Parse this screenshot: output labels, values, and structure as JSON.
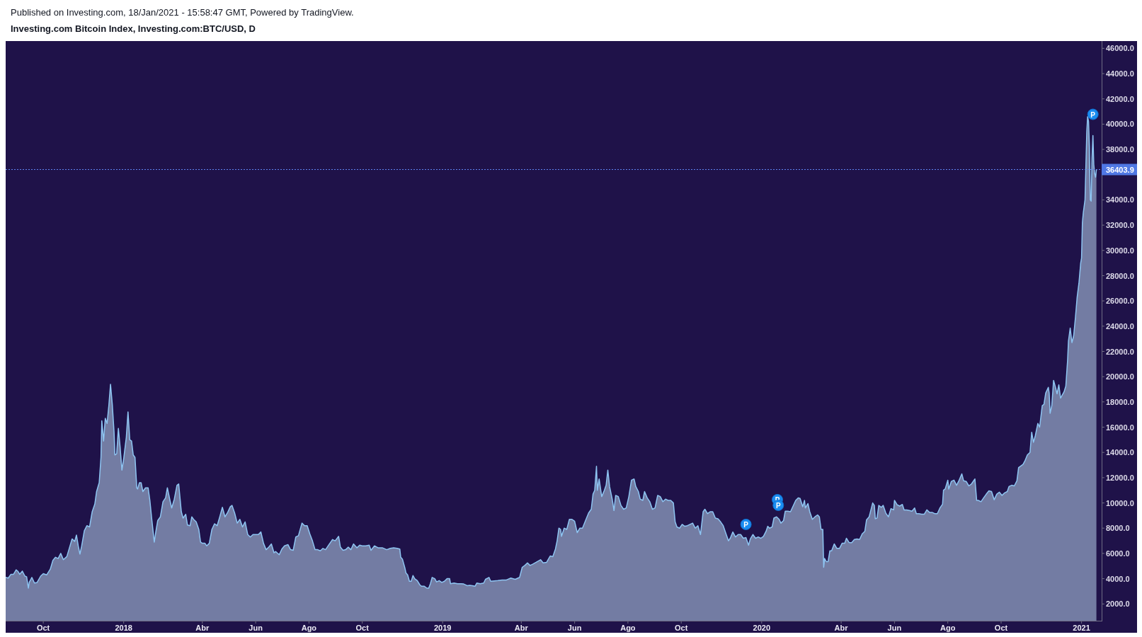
{
  "header": {
    "published": "Published on Investing.com, 18/Jan/2021 - 15:58:47 GMT, Powered by TradingView.",
    "title": "Investing.com Bitcoin Index, Investing.com:BTC/USD, D"
  },
  "chart": {
    "chart_data": {
      "type": "area",
      "x": [
        "2017-08-19",
        "2017-08-22",
        "2017-08-25",
        "2017-08-28",
        "2017-08-31",
        "2017-09-02",
        "2017-09-04",
        "2017-09-07",
        "2017-09-10",
        "2017-09-12",
        "2017-09-14",
        "2017-09-15",
        "2017-09-18",
        "2017-09-21",
        "2017-09-24",
        "2017-09-28",
        "2017-10-01",
        "2017-10-05",
        "2017-10-09",
        "2017-10-12",
        "2017-10-15",
        "2017-10-18",
        "2017-10-21",
        "2017-10-24",
        "2017-10-28",
        "2017-10-31",
        "2017-11-03",
        "2017-11-06",
        "2017-11-08",
        "2017-11-10",
        "2017-11-12",
        "2017-11-14",
        "2017-11-17",
        "2017-11-20",
        "2017-11-23",
        "2017-11-26",
        "2017-11-29",
        "2017-12-01",
        "2017-12-04",
        "2017-12-06",
        "2017-12-07",
        "2017-12-09",
        "2017-12-11",
        "2017-12-13",
        "2017-12-15",
        "2017-12-17",
        "2017-12-19",
        "2017-12-21",
        "2017-12-22",
        "2017-12-24",
        "2017-12-26",
        "2017-12-28",
        "2017-12-30",
        "2018-01-01",
        "2018-01-04",
        "2018-01-06",
        "2018-01-08",
        "2018-01-10",
        "2018-01-12",
        "2018-01-14",
        "2018-01-16",
        "2018-01-17",
        "2018-01-19",
        "2018-01-21",
        "2018-01-23",
        "2018-01-26",
        "2018-01-29",
        "2018-01-31",
        "2018-02-02",
        "2018-02-05",
        "2018-02-07",
        "2018-02-09",
        "2018-02-12",
        "2018-02-15",
        "2018-02-18",
        "2018-02-20",
        "2018-02-23",
        "2018-02-25",
        "2018-02-28",
        "2018-03-03",
        "2018-03-05",
        "2018-03-08",
        "2018-03-10",
        "2018-03-13",
        "2018-03-15",
        "2018-03-18",
        "2018-03-20",
        "2018-03-22",
        "2018-03-25",
        "2018-03-28",
        "2018-03-30",
        "2018-04-01",
        "2018-04-04",
        "2018-04-06",
        "2018-04-09",
        "2018-04-12",
        "2018-04-15",
        "2018-04-18",
        "2018-04-21",
        "2018-04-24",
        "2018-04-27",
        "2018-04-30",
        "2018-05-03",
        "2018-05-05",
        "2018-05-08",
        "2018-05-11",
        "2018-05-14",
        "2018-05-17",
        "2018-05-20",
        "2018-05-23",
        "2018-05-26",
        "2018-05-29",
        "2018-06-01",
        "2018-06-04",
        "2018-06-07",
        "2018-06-10",
        "2018-06-13",
        "2018-06-16",
        "2018-06-19",
        "2018-06-22",
        "2018-06-24",
        "2018-06-28",
        "2018-07-01",
        "2018-07-04",
        "2018-07-08",
        "2018-07-11",
        "2018-07-14",
        "2018-07-17",
        "2018-07-20",
        "2018-07-24",
        "2018-07-27",
        "2018-07-30",
        "2018-08-02",
        "2018-08-05",
        "2018-08-08",
        "2018-08-11",
        "2018-08-14",
        "2018-08-17",
        "2018-08-20",
        "2018-08-24",
        "2018-08-28",
        "2018-08-31",
        "2018-09-04",
        "2018-09-06",
        "2018-09-09",
        "2018-09-12",
        "2018-09-15",
        "2018-09-18",
        "2018-09-21",
        "2018-09-25",
        "2018-09-28",
        "2018-10-01",
        "2018-10-05",
        "2018-10-09",
        "2018-10-11",
        "2018-10-15",
        "2018-10-19",
        "2018-10-24",
        "2018-10-29",
        "2018-11-02",
        "2018-11-06",
        "2018-11-10",
        "2018-11-13",
        "2018-11-14",
        "2018-11-16",
        "2018-11-19",
        "2018-11-20",
        "2018-11-22",
        "2018-11-24",
        "2018-11-26",
        "2018-11-28",
        "2018-11-30",
        "2018-12-03",
        "2018-12-06",
        "2018-12-08",
        "2018-12-11",
        "2018-12-14",
        "2018-12-16",
        "2018-12-18",
        "2018-12-20",
        "2018-12-23",
        "2018-12-25",
        "2018-12-28",
        "2018-12-31",
        "2019-01-03",
        "2019-01-06",
        "2019-01-09",
        "2019-01-10",
        "2019-01-14",
        "2019-01-18",
        "2019-01-22",
        "2019-01-25",
        "2019-01-29",
        "2019-02-01",
        "2019-02-04",
        "2019-02-07",
        "2019-02-09",
        "2019-02-13",
        "2019-02-17",
        "2019-02-19",
        "2019-02-23",
        "2019-02-25",
        "2019-03-01",
        "2019-03-05",
        "2019-03-10",
        "2019-03-15",
        "2019-03-20",
        "2019-03-25",
        "2019-03-30",
        "2019-04-02",
        "2019-04-05",
        "2019-04-08",
        "2019-04-11",
        "2019-04-14",
        "2019-04-18",
        "2019-04-23",
        "2019-04-26",
        "2019-04-30",
        "2019-05-04",
        "2019-05-07",
        "2019-05-10",
        "2019-05-12",
        "2019-05-14",
        "2019-05-16",
        "2019-05-17",
        "2019-05-20",
        "2019-05-23",
        "2019-05-26",
        "2019-05-29",
        "2019-06-01",
        "2019-06-04",
        "2019-06-07",
        "2019-06-10",
        "2019-06-14",
        "2019-06-17",
        "2019-06-20",
        "2019-06-22",
        "2019-06-24",
        "2019-06-26",
        "2019-06-27",
        "2019-06-29",
        "2019-07-02",
        "2019-07-05",
        "2019-07-07",
        "2019-07-09",
        "2019-07-11",
        "2019-07-14",
        "2019-07-16",
        "2019-07-18",
        "2019-07-21",
        "2019-07-24",
        "2019-07-27",
        "2019-07-30",
        "2019-08-02",
        "2019-08-05",
        "2019-08-08",
        "2019-08-10",
        "2019-08-13",
        "2019-08-15",
        "2019-08-18",
        "2019-08-20",
        "2019-08-23",
        "2019-08-26",
        "2019-08-29",
        "2019-09-01",
        "2019-09-04",
        "2019-09-07",
        "2019-09-10",
        "2019-09-13",
        "2019-09-16",
        "2019-09-19",
        "2019-09-22",
        "2019-09-24",
        "2019-09-26",
        "2019-09-29",
        "2019-10-02",
        "2019-10-05",
        "2019-10-08",
        "2019-10-11",
        "2019-10-14",
        "2019-10-17",
        "2019-10-20",
        "2019-10-23",
        "2019-10-25",
        "2019-10-26",
        "2019-10-28",
        "2019-10-31",
        "2019-11-03",
        "2019-11-06",
        "2019-11-09",
        "2019-11-12",
        "2019-11-15",
        "2019-11-18",
        "2019-11-21",
        "2019-11-24",
        "2019-11-26",
        "2019-11-29",
        "2019-12-02",
        "2019-12-05",
        "2019-12-08",
        "2019-12-11",
        "2019-12-14",
        "2019-12-17",
        "2019-12-19",
        "2019-12-22",
        "2019-12-25",
        "2019-12-28",
        "2019-12-31",
        "2020-01-03",
        "2020-01-06",
        "2020-01-08",
        "2020-01-10",
        "2020-01-13",
        "2020-01-15",
        "2020-01-18",
        "2020-01-21",
        "2020-01-23",
        "2020-01-26",
        "2020-01-28",
        "2020-01-31",
        "2020-02-03",
        "2020-02-06",
        "2020-02-09",
        "2020-02-12",
        "2020-02-14",
        "2020-02-17",
        "2020-02-19",
        "2020-02-20",
        "2020-02-23",
        "2020-02-25",
        "2020-02-28",
        "2020-03-02",
        "2020-03-05",
        "2020-03-07",
        "2020-03-09",
        "2020-03-11",
        "2020-03-12",
        "2020-03-13",
        "2020-03-15",
        "2020-03-17",
        "2020-03-19",
        "2020-03-21",
        "2020-03-24",
        "2020-03-27",
        "2020-03-30",
        "2020-04-02",
        "2020-04-05",
        "2020-04-07",
        "2020-04-10",
        "2020-04-13",
        "2020-04-16",
        "2020-04-19",
        "2020-04-22",
        "2020-04-25",
        "2020-04-28",
        "2020-04-30",
        "2020-05-03",
        "2020-05-07",
        "2020-05-09",
        "2020-05-10",
        "2020-05-12",
        "2020-05-14",
        "2020-05-17",
        "2020-05-19",
        "2020-05-22",
        "2020-05-25",
        "2020-05-28",
        "2020-05-31",
        "2020-06-01",
        "2020-06-04",
        "2020-06-07",
        "2020-06-10",
        "2020-06-12",
        "2020-06-15",
        "2020-06-18",
        "2020-06-21",
        "2020-06-24",
        "2020-06-26",
        "2020-06-29",
        "2020-07-02",
        "2020-07-05",
        "2020-07-08",
        "2020-07-11",
        "2020-07-14",
        "2020-07-17",
        "2020-07-20",
        "2020-07-23",
        "2020-07-26",
        "2020-07-27",
        "2020-07-29",
        "2020-08-01",
        "2020-08-02",
        "2020-08-05",
        "2020-08-08",
        "2020-08-11",
        "2020-08-14",
        "2020-08-17",
        "2020-08-19",
        "2020-08-22",
        "2020-08-25",
        "2020-08-28",
        "2020-09-01",
        "2020-09-03",
        "2020-09-05",
        "2020-09-08",
        "2020-09-11",
        "2020-09-14",
        "2020-09-17",
        "2020-09-20",
        "2020-09-23",
        "2020-09-26",
        "2020-09-29",
        "2020-10-02",
        "2020-10-05",
        "2020-10-08",
        "2020-10-10",
        "2020-10-13",
        "2020-10-16",
        "2020-10-19",
        "2020-10-21",
        "2020-10-23",
        "2020-10-26",
        "2020-10-28",
        "2020-10-31",
        "2020-11-03",
        "2020-11-05",
        "2020-11-07",
        "2020-11-09",
        "2020-11-12",
        "2020-11-14",
        "2020-11-17",
        "2020-11-19",
        "2020-11-21",
        "2020-11-24",
        "2020-11-25",
        "2020-11-26",
        "2020-11-28",
        "2020-11-30",
        "2020-12-02",
        "2020-12-04",
        "2020-12-06",
        "2020-12-08",
        "2020-12-10",
        "2020-12-12",
        "2020-12-14",
        "2020-12-16",
        "2020-12-17",
        "2020-12-19",
        "2020-12-21",
        "2020-12-23",
        "2020-12-25",
        "2020-12-27",
        "2020-12-29",
        "2020-12-31",
        "2021-01-01",
        "2021-01-02",
        "2021-01-03",
        "2021-01-05",
        "2021-01-06",
        "2021-01-07",
        "2021-01-08",
        "2021-01-09",
        "2021-01-10",
        "2021-01-11",
        "2021-01-12",
        "2021-01-13",
        "2021-01-14",
        "2021-01-15",
        "2021-01-16",
        "2021-01-17",
        "2021-01-18"
      ],
      "series": [
        {
          "color": "#8ec5f2",
          "values": [
            4100,
            4050,
            4350,
            4350,
            4700,
            4580,
            4350,
            4600,
            4200,
            4150,
            3250,
            3700,
            4100,
            3650,
            3700,
            4200,
            4400,
            4300,
            4750,
            5450,
            5700,
            5600,
            6000,
            5500,
            5750,
            6450,
            7150,
            6950,
            7450,
            6600,
            5950,
            6600,
            7800,
            8200,
            8100,
            9300,
            9900,
            10900,
            11600,
            13600,
            16500,
            14900,
            16700,
            16300,
            17700,
            19400,
            17800,
            15600,
            13800,
            13900,
            15900,
            14400,
            12600,
            13500,
            15200,
            17200,
            15000,
            14900,
            13800,
            13600,
            11200,
            11100,
            11600,
            11600,
            10900,
            11200,
            11200,
            10200,
            8800,
            6900,
            7800,
            8600,
            8900,
            10100,
            10400,
            11200,
            10200,
            9600,
            10300,
            11400,
            11500,
            9300,
            8800,
            9100,
            8250,
            8200,
            8900,
            8700,
            8500,
            7900,
            6900,
            6800,
            6800,
            6600,
            6800,
            7900,
            8350,
            8200,
            8900,
            9650,
            8900,
            9250,
            9700,
            9800,
            9200,
            8400,
            8700,
            8100,
            8500,
            7500,
            7300,
            7500,
            7500,
            7500,
            7700,
            6800,
            6300,
            6500,
            6750,
            6050,
            6150,
            5900,
            6350,
            6600,
            6700,
            6300,
            6250,
            7300,
            7400,
            8400,
            8200,
            8200,
            7550,
            7000,
            6300,
            6300,
            6200,
            6400,
            6300,
            6700,
            7100,
            7000,
            7350,
            6500,
            6250,
            6300,
            6500,
            6300,
            6750,
            6450,
            6650,
            6600,
            6600,
            6650,
            6250,
            6600,
            6450,
            6450,
            6300,
            6400,
            6450,
            6400,
            6350,
            5700,
            5550,
            4800,
            4450,
            4300,
            3800,
            3800,
            4250,
            4000,
            3850,
            3500,
            3400,
            3400,
            3250,
            3250,
            3600,
            4100,
            4000,
            3750,
            3850,
            3700,
            3800,
            4000,
            4000,
            3600,
            3650,
            3600,
            3600,
            3580,
            3450,
            3480,
            3450,
            3400,
            3650,
            3600,
            3650,
            3950,
            4100,
            3800,
            3820,
            3850,
            3900,
            3900,
            4050,
            3950,
            4100,
            4900,
            5050,
            5250,
            5050,
            5150,
            5300,
            5500,
            5250,
            5300,
            5800,
            5750,
            6350,
            7000,
            8000,
            7900,
            7350,
            8000,
            7900,
            8700,
            8700,
            8550,
            7650,
            8000,
            8000,
            8700,
            9200,
            9500,
            10700,
            11000,
            12900,
            11000,
            11900,
            10500,
            11000,
            11400,
            12600,
            11300,
            10300,
            9400,
            10600,
            10500,
            9800,
            9500,
            9600,
            10500,
            11800,
            11900,
            11300,
            10900,
            10300,
            10200,
            10900,
            10400,
            10100,
            9500,
            9600,
            10600,
            10500,
            10100,
            10300,
            10200,
            10200,
            10000,
            8500,
            8100,
            8000,
            8300,
            8150,
            8200,
            8300,
            8400,
            8000,
            8200,
            7500,
            8700,
            9300,
            9500,
            9150,
            9300,
            9300,
            8800,
            8750,
            8500,
            8200,
            7600,
            7000,
            7200,
            7700,
            7300,
            7500,
            7500,
            7200,
            7250,
            6650,
            7150,
            7500,
            7200,
            7300,
            7200,
            7350,
            7750,
            8150,
            8000,
            8100,
            8800,
            8900,
            8700,
            8400,
            8600,
            9350,
            9350,
            9300,
            9750,
            10200,
            10400,
            10350,
            9700,
            10200,
            9600,
            9950,
            9300,
            8700,
            8900,
            9050,
            8900,
            7900,
            7900,
            4900,
            5600,
            5350,
            5350,
            6200,
            6200,
            6750,
            6400,
            6400,
            6800,
            6800,
            7200,
            6870,
            6850,
            7100,
            7150,
            7100,
            7550,
            7750,
            8650,
            8900,
            10000,
            9800,
            8750,
            8800,
            9800,
            9650,
            9800,
            9200,
            8900,
            9550,
            9450,
            10200,
            9850,
            9750,
            9880,
            9450,
            9450,
            9400,
            9350,
            9600,
            9150,
            9150,
            9100,
            9100,
            9450,
            9250,
            9250,
            9150,
            9150,
            9600,
            9900,
            11000,
            11100,
            11800,
            11100,
            11700,
            11800,
            11400,
            11800,
            12300,
            11750,
            11700,
            11350,
            11500,
            11900,
            10200,
            10200,
            10100,
            10400,
            10700,
            10950,
            10900,
            10250,
            10700,
            10850,
            10600,
            10800,
            10900,
            11300,
            11400,
            11350,
            11750,
            12800,
            12900,
            13050,
            13300,
            13800,
            14000,
            15600,
            14800,
            15300,
            16300,
            16000,
            17700,
            17800,
            18700,
            19150,
            18700,
            17100,
            17700,
            19700,
            19200,
            18650,
            19350,
            18300,
            18550,
            18800,
            19250,
            21300,
            22800,
            23850,
            22700,
            23250,
            24700,
            26300,
            27400,
            29000,
            29400,
            32200,
            33000,
            34000,
            36800,
            39400,
            40600,
            40200,
            38200,
            34000,
            33900,
            37300,
            39100,
            36800,
            36100,
            35800,
            36400
          ]
        }
      ],
      "xlim": [
        "2017-08-19",
        "2021-01-24"
      ],
      "ylim": [
        670,
        46580
      ],
      "xticks": [
        {
          "value": "2017-10-01",
          "label": "Oct"
        },
        {
          "value": "2018-01-01",
          "label": "2018"
        },
        {
          "value": "2018-04-01",
          "label": "Abr"
        },
        {
          "value": "2018-06-01",
          "label": "Jun"
        },
        {
          "value": "2018-08-01",
          "label": "Ago"
        },
        {
          "value": "2018-10-01",
          "label": "Oct"
        },
        {
          "value": "2019-01-01",
          "label": "2019"
        },
        {
          "value": "2019-04-01",
          "label": "Abr"
        },
        {
          "value": "2019-06-01",
          "label": "Jun"
        },
        {
          "value": "2019-08-01",
          "label": "Ago"
        },
        {
          "value": "2019-10-01",
          "label": "Oct"
        },
        {
          "value": "2020-01-01",
          "label": "2020"
        },
        {
          "value": "2020-04-01",
          "label": "Abr"
        },
        {
          "value": "2020-06-01",
          "label": "Jun"
        },
        {
          "value": "2020-08-01",
          "label": "Ago"
        },
        {
          "value": "2020-10-01",
          "label": "Oct"
        },
        {
          "value": "2021-01-01",
          "label": "2021"
        }
      ],
      "yticks": [
        {
          "value": 2000,
          "label": "2000.0"
        },
        {
          "value": 4000,
          "label": "4000.0"
        },
        {
          "value": 6000,
          "label": "6000.0"
        },
        {
          "value": 8000,
          "label": "8000.0"
        },
        {
          "value": 10000,
          "label": "10000.0"
        },
        {
          "value": 12000,
          "label": "12000.0"
        },
        {
          "value": 14000,
          "label": "14000.0"
        },
        {
          "value": 16000,
          "label": "16000.0"
        },
        {
          "value": 18000,
          "label": "18000.0"
        },
        {
          "value": 20000,
          "label": "20000.0"
        },
        {
          "value": 22000,
          "label": "22000.0"
        },
        {
          "value": 24000,
          "label": "24000.0"
        },
        {
          "value": 26000,
          "label": "26000.0"
        },
        {
          "value": 28000,
          "label": "28000.0"
        },
        {
          "value": 30000,
          "label": "30000.0"
        },
        {
          "value": 32000,
          "label": "32000.0"
        },
        {
          "value": 34000,
          "label": "34000.0"
        },
        {
          "value": 38000,
          "label": "38000.0"
        },
        {
          "value": 40000,
          "label": "40000.0"
        },
        {
          "value": 42000,
          "label": "42000.0"
        },
        {
          "value": 44000,
          "label": "44000.0"
        },
        {
          "value": 46000,
          "label": "46000.0"
        }
      ],
      "ref_lines": [
        {
          "axis": "y",
          "value": 36403.9,
          "label": "36403.9"
        }
      ],
      "annotations": [
        {
          "x": "2019-12-14",
          "y": 8300,
          "text": "P"
        },
        {
          "x": "2020-01-19",
          "y": 10260,
          "text": "P"
        },
        {
          "x": "2020-01-20",
          "y": 9810,
          "text": "P"
        },
        {
          "x": "2021-01-14",
          "y": 40780,
          "text": "P"
        }
      ]
    }
  }
}
